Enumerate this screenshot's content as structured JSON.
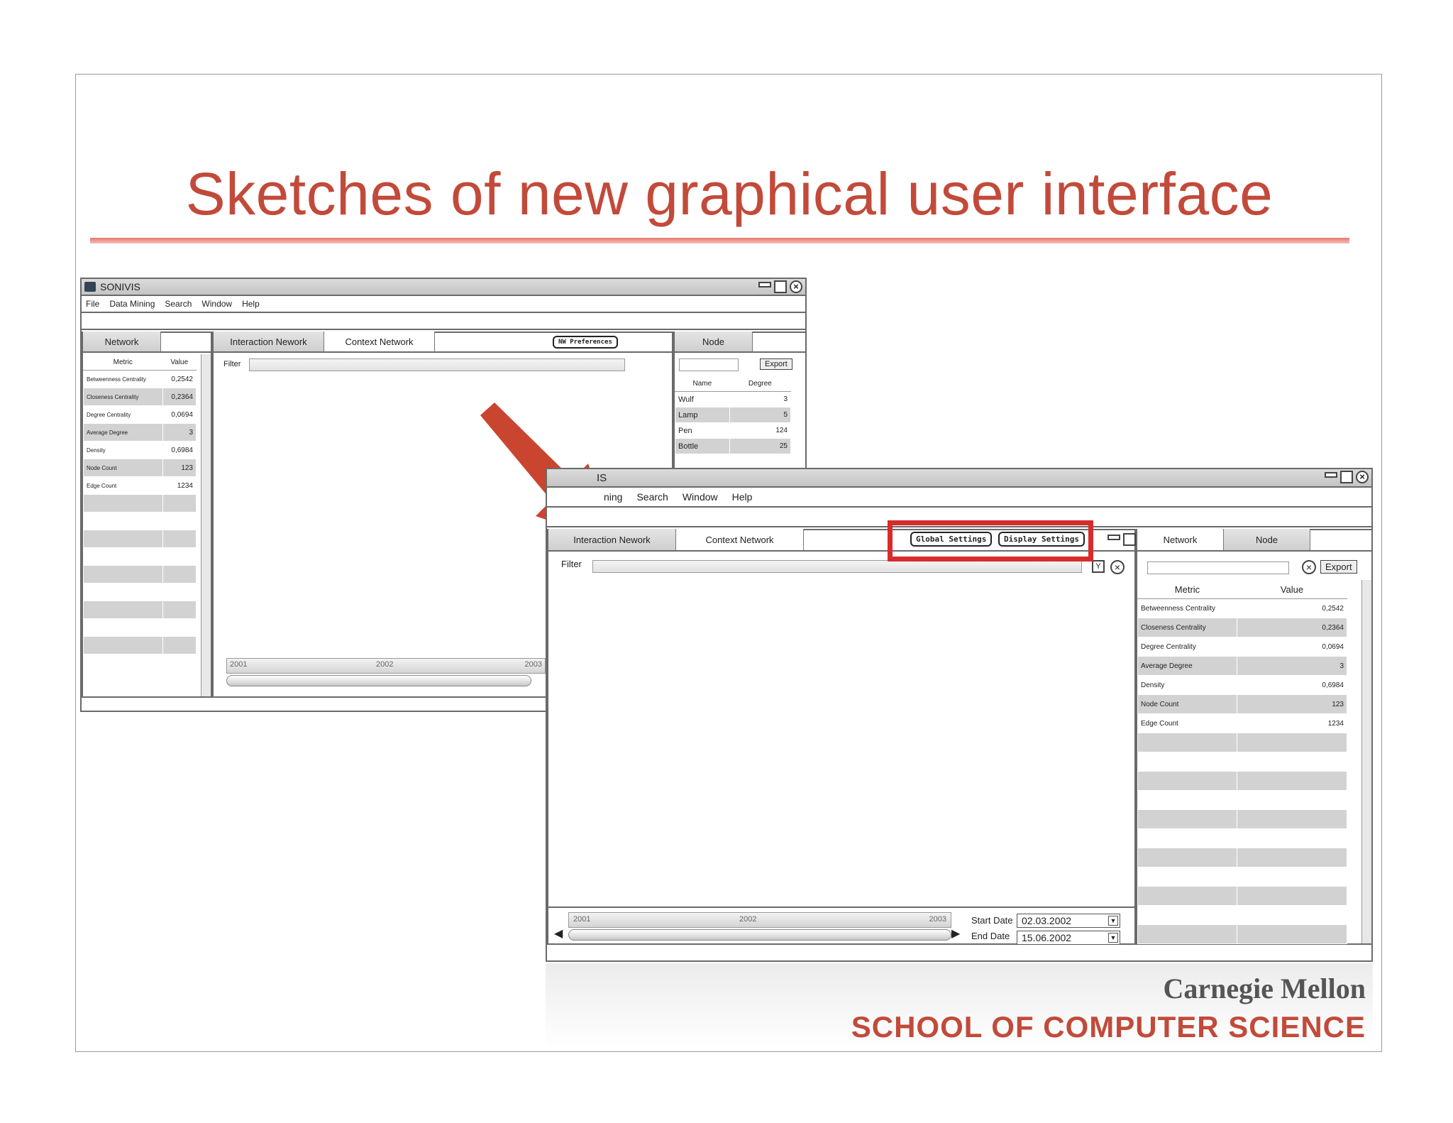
{
  "slide": {
    "title": "Sketches of new graphical user interface",
    "footer_university": "Carnegie Mellon",
    "footer_school": "SCHOOL OF COMPUTER SCIENCE"
  },
  "back_window": {
    "title": "SONIVIS",
    "menu": [
      "File",
      "Data Mining",
      "Search",
      "Window",
      "Help"
    ],
    "left_tab": "Network",
    "metric_header": "Metric",
    "value_header": "Value",
    "metrics": [
      {
        "name": "Betweenness Centrality",
        "value": "0,2542"
      },
      {
        "name": "Closeness Centrality",
        "value": "0,2364"
      },
      {
        "name": "Degree Centrality",
        "value": "0,0694"
      },
      {
        "name": "Average Degree",
        "value": "3"
      },
      {
        "name": "Density",
        "value": "0,6984"
      },
      {
        "name": "Node Count",
        "value": "123"
      },
      {
        "name": "Edge Count",
        "value": "1234"
      }
    ],
    "center_tabs": [
      "Interaction Nework",
      "Context Network"
    ],
    "nw_preferences": "NW Preferences",
    "filter_label": "Filter",
    "timeline_years": [
      "2001",
      "2002",
      "2003"
    ],
    "right_tab": "Node",
    "export_label": "Export",
    "name_header": "Name",
    "degree_header": "Degree",
    "nodes": [
      {
        "name": "Wulf",
        "degree": "3"
      },
      {
        "name": "Lamp",
        "degree": "5"
      },
      {
        "name": "Pen",
        "degree": "124"
      },
      {
        "name": "Bottle",
        "degree": "25"
      }
    ]
  },
  "front_window": {
    "title": "IS",
    "menu": [
      "ning",
      "Search",
      "Window",
      "Help"
    ],
    "center_tabs": [
      "Interaction Nework",
      "Context Network"
    ],
    "global_settings": "Global Settings",
    "display_settings": "Display Settings",
    "filter_label": "Filter",
    "timeline_years": [
      "2001",
      "2002",
      "2003"
    ],
    "start_date_label": "Start Date",
    "start_date": "02.03.2002",
    "end_date_label": "End Date",
    "end_date": "15.06.2002",
    "right_tabs": [
      "Network",
      "Node"
    ],
    "export_label": "Export",
    "metric_header": "Metric",
    "value_header": "Value",
    "metrics": [
      {
        "name": "Betweenness Centrality",
        "value": "0,2542"
      },
      {
        "name": "Closeness Centrality",
        "value": "0,2364"
      },
      {
        "name": "Degree Centrality",
        "value": "0,0694"
      },
      {
        "name": "Average Degree",
        "value": "3"
      },
      {
        "name": "Density",
        "value": "0,6984"
      },
      {
        "name": "Node Count",
        "value": "123"
      },
      {
        "name": "Edge Count",
        "value": "1234"
      }
    ]
  },
  "colors": {
    "title": "#c24a3a",
    "arrow": "#c9452f",
    "highlight": "#d92b2b"
  }
}
